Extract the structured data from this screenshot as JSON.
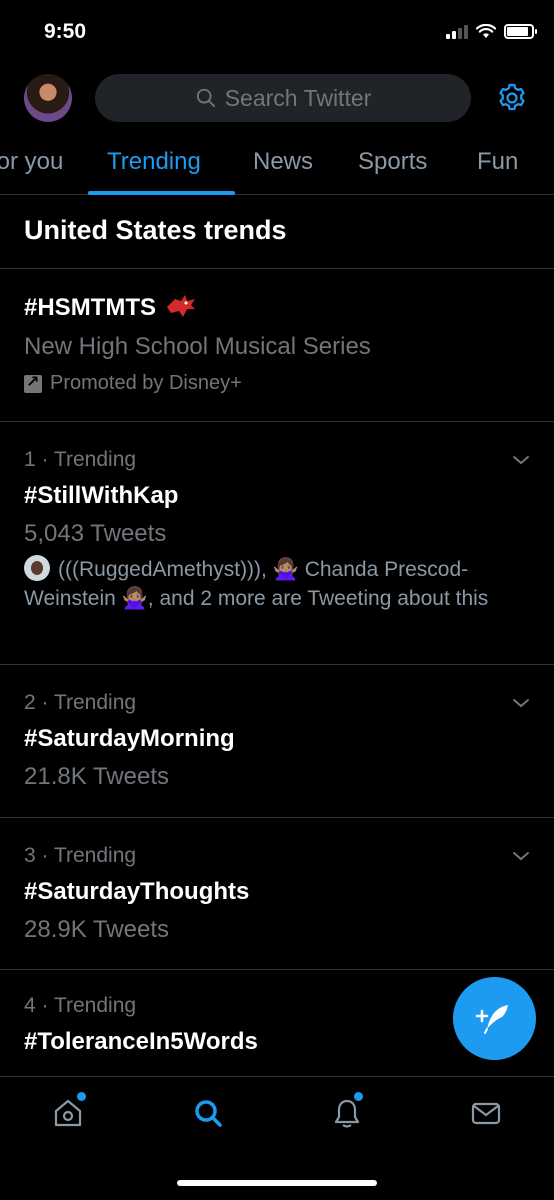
{
  "status_bar": {
    "time": "9:50"
  },
  "search": {
    "placeholder": "Search Twitter"
  },
  "tabs": [
    {
      "label": "For you"
    },
    {
      "label": "Trending"
    },
    {
      "label": "News"
    },
    {
      "label": "Sports"
    },
    {
      "label": "Fun"
    }
  ],
  "active_tab": "Trending",
  "section_title": "United States trends",
  "promoted": {
    "tag": "#HSMTMTS",
    "description": "New High School Musical Series",
    "promoted_by": "Promoted by Disney+"
  },
  "trends": [
    {
      "meta": "1 · Trending",
      "tag": "#StillWithKap",
      "count": "5,043 Tweets",
      "context": "(((RuggedAmethyst))), 🙅🏽‍♀️ Chanda Prescod-Weinstein 🙅🏽‍♀️, and 2 more are Tweeting about this"
    },
    {
      "meta": "2 · Trending",
      "tag": "#SaturdayMorning",
      "count": "21.8K Tweets"
    },
    {
      "meta": "3 · Trending",
      "tag": "#SaturdayThoughts",
      "count": "28.9K Tweets"
    },
    {
      "meta": "4 · Trending",
      "tag": "#ToleranceIn5Words",
      "count": ""
    }
  ],
  "colors": {
    "accent": "#1d9bf0",
    "background": "#000000",
    "secondary_text": "#71767b"
  },
  "icons": [
    "search-icon",
    "gear-icon",
    "chevron-down-icon",
    "compose-tweet-icon",
    "home-icon",
    "explore-icon",
    "notifications-icon",
    "messages-icon"
  ]
}
